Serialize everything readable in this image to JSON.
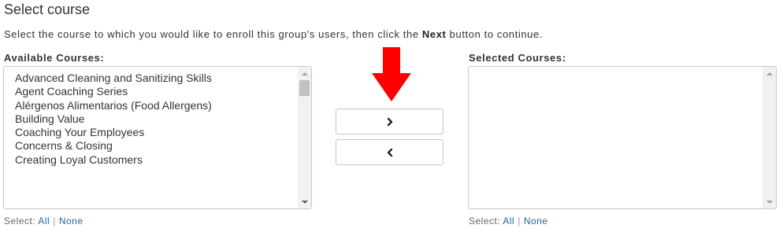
{
  "page": {
    "title": "Select course",
    "instructions_before": "Select the course to which you would like to enroll this group's users, then click the ",
    "instructions_bold": "Next",
    "instructions_after": " button to continue."
  },
  "available": {
    "label": "Available Courses:",
    "items": [
      "Advanced Cleaning and Sanitizing Skills",
      "Agent Coaching Series",
      "Alérgenos Alimentarios (Food Allergens)",
      "Building Value",
      "Coaching Your Employees",
      "Concerns & Closing",
      "Creating Loyal Customers"
    ],
    "select_prefix": "Select:",
    "select_all": "All",
    "separator": "|",
    "select_none": "None"
  },
  "selected": {
    "label": "Selected Courses:",
    "items": [],
    "select_prefix": "Select:",
    "select_all": "All",
    "separator": "|",
    "select_none": "None"
  },
  "controls": {
    "add_icon": "chevron-right-icon",
    "remove_icon": "chevron-left-icon",
    "annotation_icon": "red-down-arrow-icon"
  },
  "colors": {
    "annotation_arrow": "#ff0000",
    "link": "#2a6496"
  }
}
